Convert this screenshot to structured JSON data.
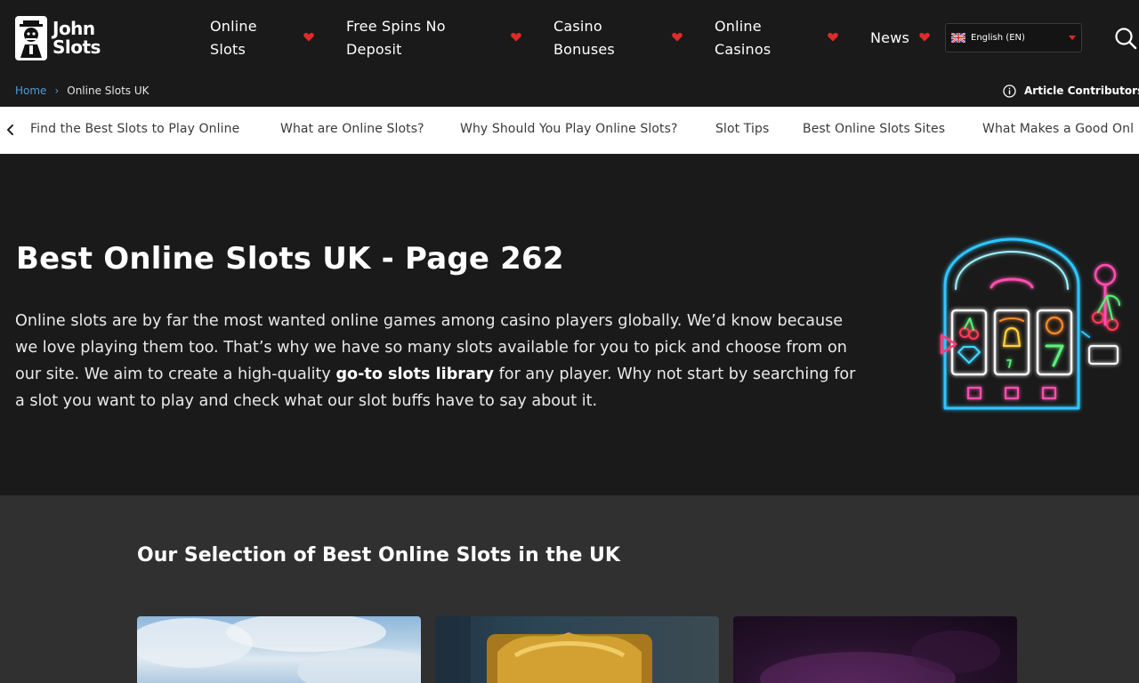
{
  "brand": {
    "line1": "John",
    "line2": "Slots"
  },
  "nav": {
    "items": [
      {
        "label_line1": "Online",
        "label_line2": "Slots"
      },
      {
        "label_line1": "Free Spins No",
        "label_line2": "Deposit"
      },
      {
        "label_line1": "Casino",
        "label_line2": "Bonuses"
      },
      {
        "label_line1": "Online",
        "label_line2": "Casinos"
      },
      {
        "label_line1": "News",
        "label_line2": ""
      }
    ],
    "language": "English (EN)",
    "accent": "#e12a2a"
  },
  "breadcrumb": {
    "home": "Home",
    "separator": "›",
    "current": "Online Slots UK"
  },
  "contributors": {
    "label": "Article Contributors:"
  },
  "tabs": [
    "Find the Best Slots to Play Online",
    "What are Online Slots?",
    "Why Should You Play Online Slots?",
    "Slot Tips",
    "Best Online Slots Sites",
    "What Makes a Good Onl"
  ],
  "hero": {
    "title": "Best Online Slots UK - Page 262",
    "text_before": "Online slots are by far the most wanted online games among casino players globally. We’d know because we love playing them too. That’s why we have so many slots available for you to pick and choose from on our site. We aim to create a high-quality ",
    "text_bold": "go-to slots library",
    "text_after": " for any player. Why not start by searching for a slot you want to play and check what our slot buffs have to say about it."
  },
  "selection": {
    "title": "Our Selection of Best Online Slots in the UK"
  },
  "icons": {
    "logo": "john-slots-logo",
    "nav_caret": "heart-icon",
    "language_flag": "uk-flag-icon",
    "search": "search-icon",
    "info": "info-icon",
    "tabs_prev": "chevron-left-icon",
    "hero_illustration": "neon-slot-machine"
  }
}
